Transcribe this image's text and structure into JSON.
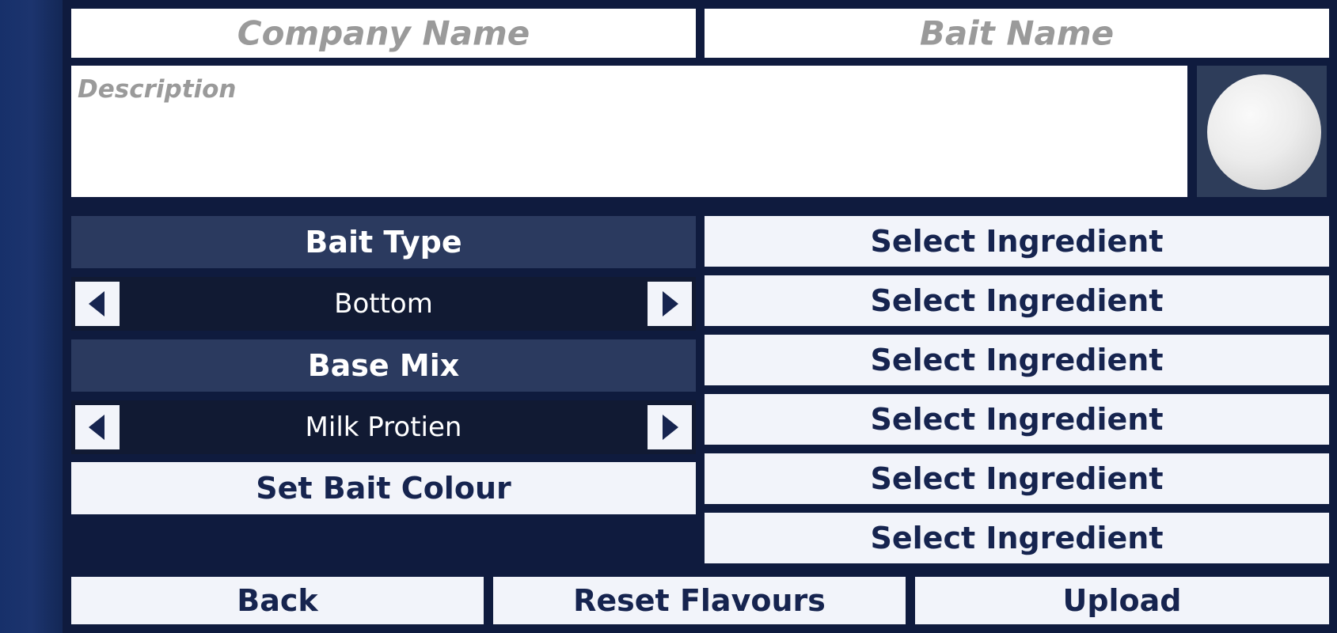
{
  "form": {
    "company_name_placeholder": "Company Name",
    "bait_name_placeholder": "Bait Name",
    "description_placeholder": "Description"
  },
  "bait_type": {
    "header": "Bait Type",
    "value": "Bottom"
  },
  "base_mix": {
    "header": "Base Mix",
    "value": "Milk Protien"
  },
  "set_colour_label": "Set Bait Colour",
  "ingredients": [
    {
      "label": "Select Ingredient"
    },
    {
      "label": "Select Ingredient"
    },
    {
      "label": "Select Ingredient"
    },
    {
      "label": "Select Ingredient"
    },
    {
      "label": "Select Ingredient"
    },
    {
      "label": "Select Ingredient"
    }
  ],
  "footer": {
    "back_label": "Back",
    "reset_label": "Reset Flavours",
    "upload_label": "Upload"
  },
  "icons": {
    "left_arrow": "chevron-left-icon",
    "right_arrow": "chevron-right-icon"
  },
  "colors": {
    "panel_bg": "#0f1b3e",
    "header_bg": "#2b3a5f",
    "selector_bg": "#111a33",
    "button_bg": "#f2f4fa",
    "button_text": "#16244f",
    "placeholder_text": "#9a9a9a"
  }
}
